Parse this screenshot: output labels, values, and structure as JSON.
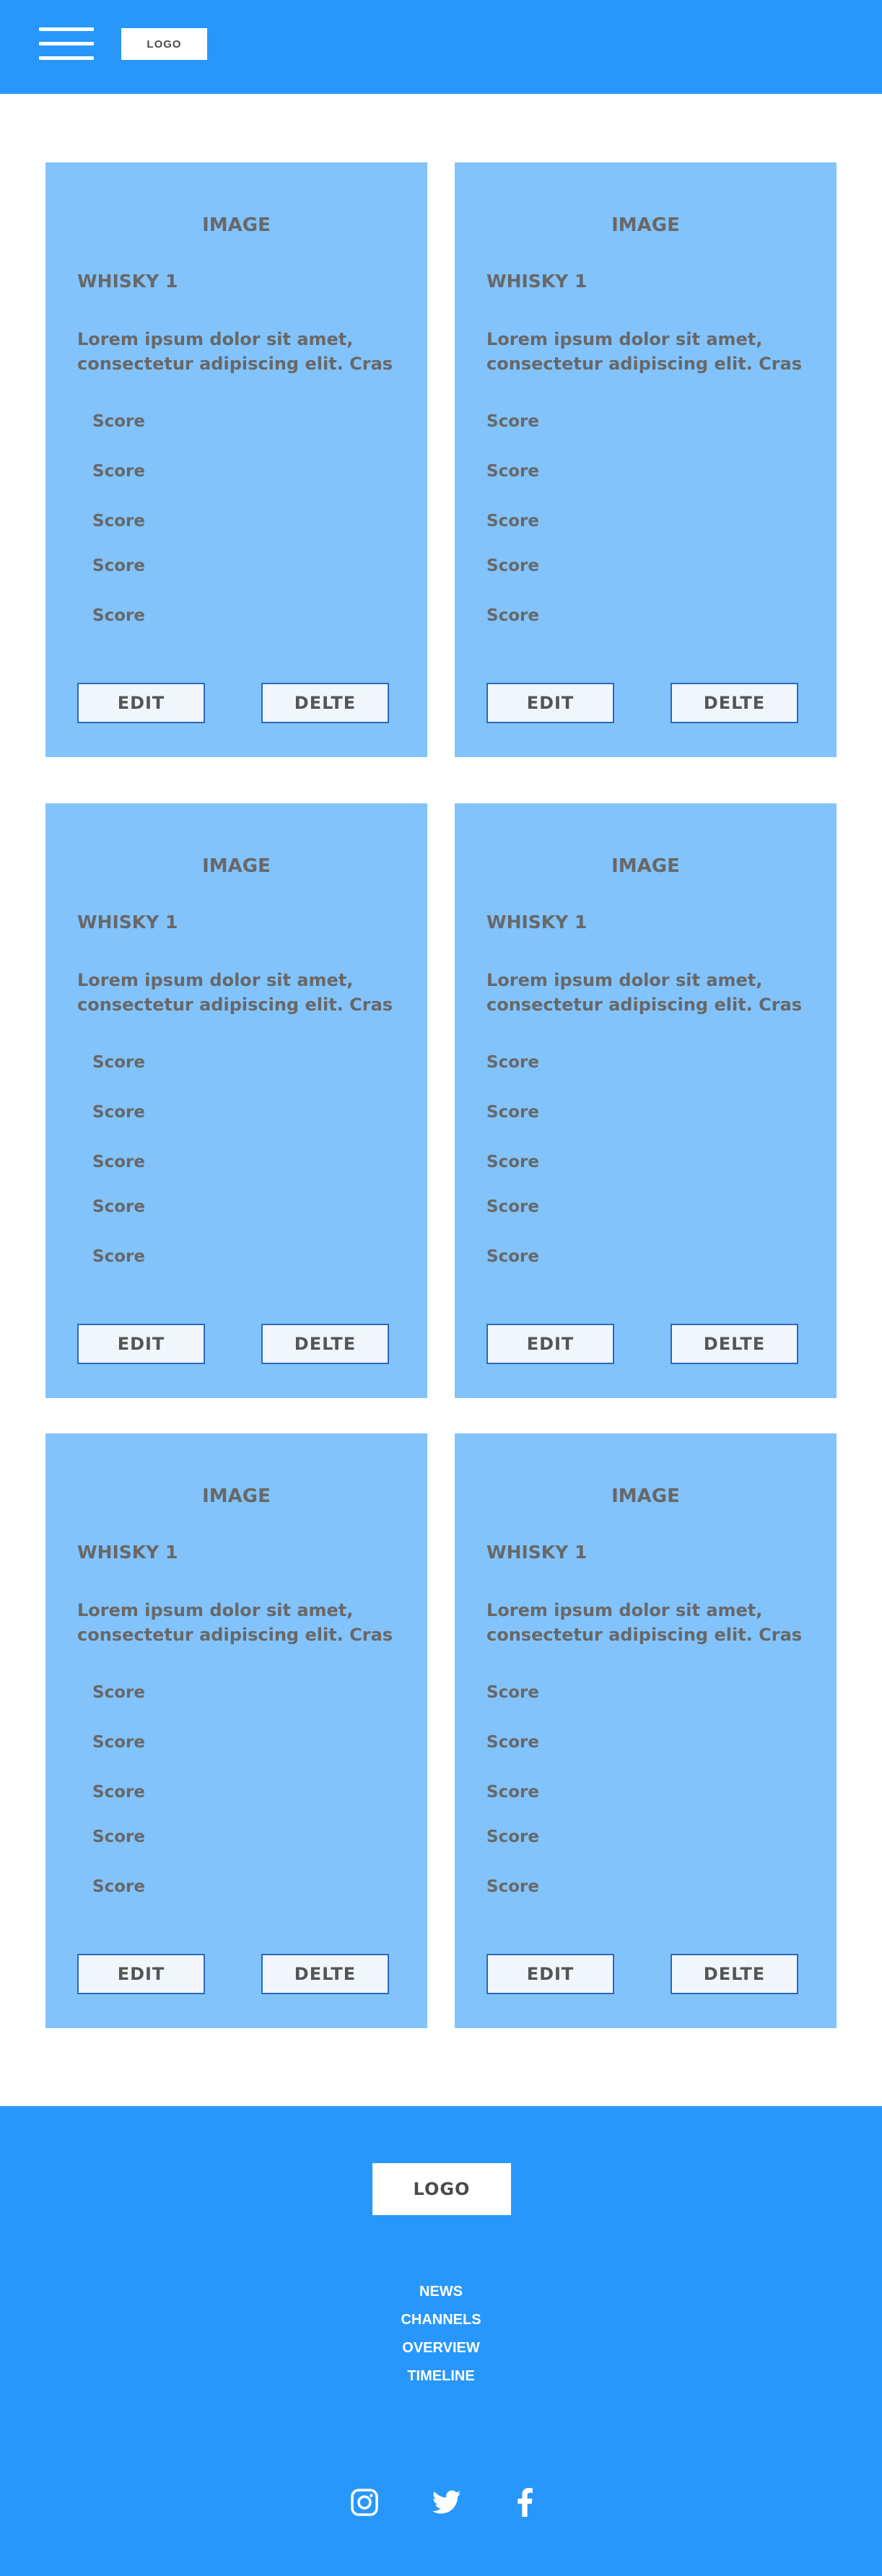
{
  "header": {
    "logo": "LOGO",
    "menu_icon": "hamburger-menu-icon"
  },
  "cards": [
    {
      "image": "IMAGE",
      "title": "WHISKY 1",
      "description": "Lorem ipsum dolor sit amet, consectetur adipiscing elit. Cras",
      "scores": [
        "Score",
        "Score",
        "Score",
        "Score",
        "Score"
      ],
      "edit_label": "EDIT",
      "delete_label": "DELTE"
    },
    {
      "image": "IMAGE",
      "title": "WHISKY 1",
      "description": "Lorem ipsum dolor sit amet, consectetur adipiscing elit. Cras",
      "scores": [
        "Score",
        "Score",
        "Score",
        "Score",
        "Score"
      ],
      "edit_label": "EDIT",
      "delete_label": "DELTE"
    },
    {
      "image": "IMAGE",
      "title": "WHISKY 1",
      "description": "Lorem ipsum dolor sit amet, consectetur adipiscing elit. Cras",
      "scores": [
        "Score",
        "Score",
        "Score",
        "Score",
        "Score"
      ],
      "edit_label": "EDIT",
      "delete_label": "DELTE"
    },
    {
      "image": "IMAGE",
      "title": "WHISKY 1",
      "description": "Lorem ipsum dolor sit amet, consectetur adipiscing elit. Cras",
      "scores": [
        "Score",
        "Score",
        "Score",
        "Score",
        "Score"
      ],
      "edit_label": "EDIT",
      "delete_label": "DELTE"
    },
    {
      "image": "IMAGE",
      "title": "WHISKY 1",
      "description": "Lorem ipsum dolor sit amet, consectetur adipiscing elit. Cras",
      "scores": [
        "Score",
        "Score",
        "Score",
        "Score",
        "Score"
      ],
      "edit_label": "EDIT",
      "delete_label": "DELTE"
    },
    {
      "image": "IMAGE",
      "title": "WHISKY 1",
      "description": "Lorem ipsum dolor sit amet, consectetur adipiscing elit. Cras",
      "scores": [
        "Score",
        "Score",
        "Score",
        "Score",
        "Score"
      ],
      "edit_label": "EDIT",
      "delete_label": "DELTE"
    }
  ],
  "footer": {
    "logo": "LOGO",
    "links": [
      "NEWS",
      "CHANNELS",
      "OVERVIEW",
      "TIMELINE"
    ],
    "social": [
      "instagram-icon",
      "twitter-icon",
      "facebook-icon"
    ]
  },
  "colors": {
    "header_bg": "#2897fb",
    "card_bg": "#82c3fb",
    "button_border": "#2a6abf",
    "text": "#686868"
  }
}
